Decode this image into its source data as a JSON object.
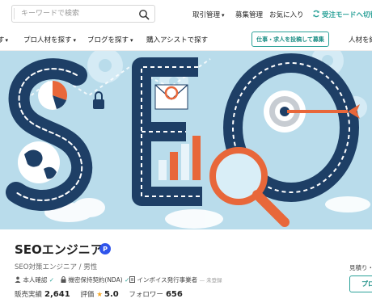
{
  "header": {
    "search": {
      "placeholder": "キーワードで検索",
      "value": ""
    },
    "links": {
      "manage": "取引管理",
      "recruit": "募集管理",
      "favorites": "お気に入り",
      "buyer_mode": "受注モードへ切替"
    }
  },
  "nav": {
    "items": [
      "す",
      "プロ人材を探す",
      "ブログを探す",
      "購入アシストで探す"
    ],
    "post_button": "仕事・求人を投稿して募集",
    "right_item": "人材を紹"
  },
  "banner": {
    "description": "SEO illustration"
  },
  "profile": {
    "name": "SEOエンジニア",
    "pro_badge": "P",
    "subtitle": "SEO対策エンジニア / 男性",
    "verifications": {
      "identity": "本人確認",
      "nda": "機密保持契約(NDA)",
      "invoice": "インボイス発行事業者",
      "invoice_status": "未登録"
    },
    "stats": {
      "sales_label": "販売実績",
      "sales_value": "2,641",
      "rating_label": "評価",
      "rating_value": "5.0",
      "followers_label": "フォロワー",
      "followers_value": "656"
    },
    "side": {
      "label": "見積り・",
      "button": "プロ"
    }
  },
  "colors": {
    "accent": "#2aa198",
    "pro_badge": "#2f54eb",
    "star": "#f5a623",
    "banner_bg": "#b9dceb",
    "navy": "#1e3f66",
    "orange": "#e8673a"
  }
}
